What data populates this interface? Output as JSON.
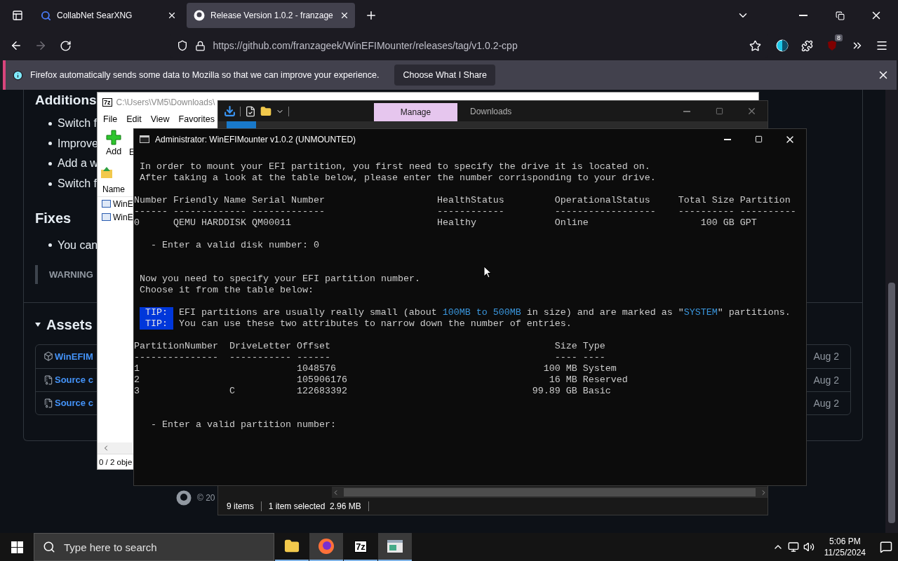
{
  "browser": {
    "tabs": [
      {
        "title": "CollabNet SearXNG",
        "selected": false
      },
      {
        "title": "Release Version 1.0.2 - franzage",
        "selected": true
      }
    ],
    "forward_disabled": true,
    "url": "https://github.com/franzageek/WinEFIMounter/releases/tag/v1.0.2-cpp",
    "extension_badge": "8",
    "notification": {
      "text": "Firefox automatically sends some data to Mozilla so that we can improve your experience.",
      "button": "Choose What I Share"
    }
  },
  "release_page": {
    "additions_heading": "Additions",
    "additions": [
      "Switch f",
      "Improve",
      "Add a w",
      "Switch f"
    ],
    "fixes_heading": "Fixes",
    "fixes": [
      "You can"
    ],
    "warning": "WARNING",
    "assets_heading": "Assets",
    "assets": [
      {
        "kind": "package",
        "name": "WinEFIM",
        "date": "Aug 2"
      },
      {
        "kind": "source",
        "name": "Source c",
        "date": "Aug 2"
      },
      {
        "kind": "source",
        "name": "Source c",
        "date": "Aug 2"
      }
    ],
    "footer": "© 20"
  },
  "archive_window": {
    "app_badge": "7z",
    "title": "C:\\Users\\VM5\\Downloads\\",
    "menu": [
      "File",
      "Edit",
      "View",
      "Favorites"
    ],
    "toolbar": [
      "Add",
      "E"
    ],
    "column": "Name",
    "files": [
      "WinE",
      "WinE"
    ],
    "status": "0 / 2 obje"
  },
  "explorer_window": {
    "context_tab": "Manage",
    "title": "Downloads",
    "status": [
      "9 items",
      "1 item selected  2.96 MB"
    ]
  },
  "terminal": {
    "title": "Administrator: WinEFIMounter v1.0.2 (UNMOUNTED)",
    "blocks": [
      {
        "kind": "text",
        "lines": [
          "In order to mount your EFI partition, you first need to specify the drive it is located on.",
          "After taking a look at the table below, please enter the number corrisponding to your drive."
        ]
      },
      {
        "kind": "blank"
      },
      {
        "kind": "disk_table",
        "columns": [
          "Number",
          "Friendly Name",
          "Serial Number",
          "HealthStatus",
          "OperationalStatus",
          "Total Size",
          "Partition"
        ],
        "rule": [
          "------",
          "-------------",
          "-------------",
          "------------",
          "------------------",
          "----------",
          "----------"
        ],
        "rows": [
          [
            "0",
            "QEMU HARDDISK",
            "QM00011",
            "Healthy",
            "Online",
            "100 GB",
            "GPT"
          ]
        ]
      },
      {
        "kind": "blank"
      },
      {
        "kind": "prompt",
        "text": "- Enter a valid disk number: 0"
      },
      {
        "kind": "blank"
      },
      {
        "kind": "blank"
      },
      {
        "kind": "text",
        "lines": [
          "Now you need to specify your EFI partition number.",
          "Choose it from the table below:"
        ]
      },
      {
        "kind": "blank"
      },
      {
        "kind": "tip",
        "lines": [
          {
            "label": "TIP:",
            "segments": [
              {
                "text": "EFI partitions are usually really small (about ",
                "highlight": false
              },
              {
                "text": "100MB to 500MB",
                "highlight": true
              },
              {
                "text": " in size) and are marked as \"",
                "highlight": false
              },
              {
                "text": "SYSTEM",
                "highlight": true
              },
              {
                "text": "\" partitions.",
                "highlight": false
              }
            ]
          },
          {
            "label": "TIP:",
            "segments": [
              {
                "text": "You can use these two attributes to narrow down the number of entries.",
                "highlight": false
              }
            ]
          }
        ]
      },
      {
        "kind": "blank"
      },
      {
        "kind": "partition_table",
        "columns": [
          "PartitionNumber",
          "DriveLetter",
          "Offset",
          "Size",
          "Type"
        ],
        "rule": [
          "---------------",
          "-----------",
          "------",
          "----",
          "----"
        ],
        "rows": [
          [
            "1",
            "",
            "1048576",
            "100 MB",
            "System"
          ],
          [
            "2",
            "",
            "105906176",
            "16 MB",
            "Reserved"
          ],
          [
            "3",
            "C",
            "122683392",
            "99.89 GB",
            "Basic"
          ]
        ]
      },
      {
        "kind": "blank"
      },
      {
        "kind": "blank"
      },
      {
        "kind": "prompt",
        "text": "- Enter a valid partition number:"
      }
    ]
  },
  "taskbar": {
    "search_placeholder": "Type here to search",
    "apps": [
      {
        "kind": "folder",
        "active": false
      },
      {
        "kind": "browser",
        "active": true
      },
      {
        "kind": "archiver",
        "label": "7z",
        "active": false
      },
      {
        "kind": "console",
        "active": true
      }
    ],
    "time": "5:06 PM",
    "date": "11/25/2024"
  }
}
